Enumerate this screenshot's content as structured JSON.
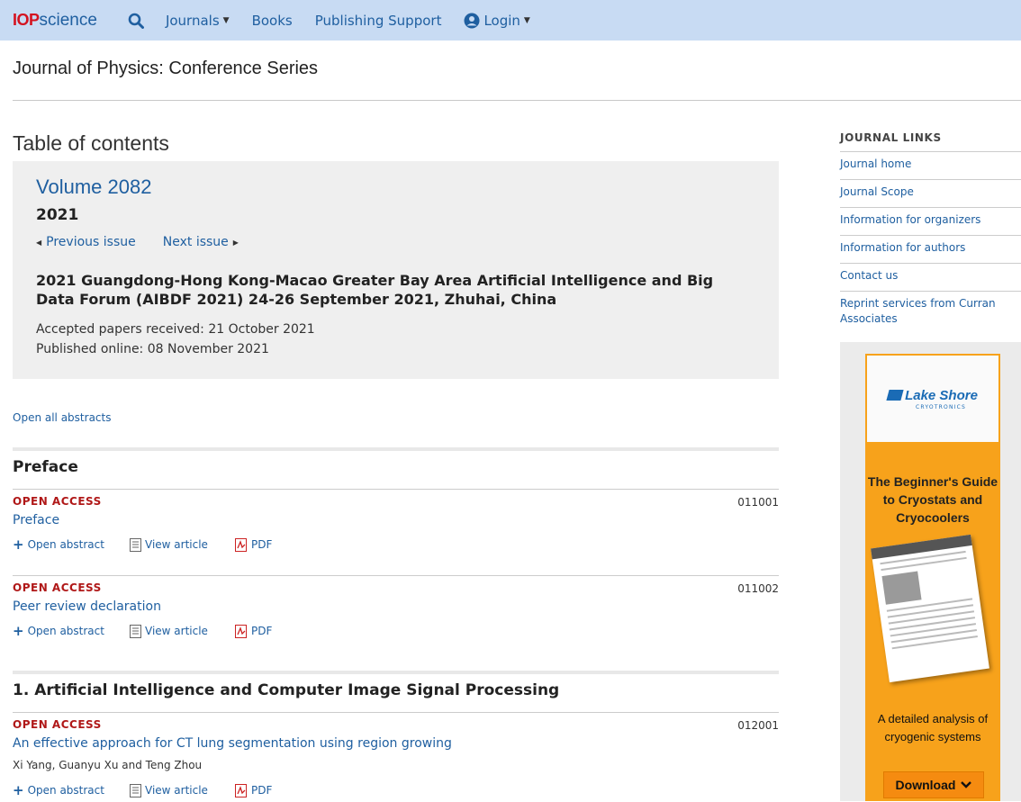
{
  "nav": {
    "logo_iop": "IOP",
    "logo_science": "science",
    "search_icon": "search-icon",
    "items": [
      "Journals",
      "Books",
      "Publishing Support"
    ],
    "login": "Login"
  },
  "journal": {
    "title": "Journal of Physics: Conference Series"
  },
  "toc": {
    "heading": "Table of contents"
  },
  "volume": {
    "title": "Volume 2082",
    "year": "2021",
    "prev": "Previous issue",
    "next": "Next issue",
    "conference": "2021 Guangdong-Hong Kong-Macao Greater Bay Area Artificial Intelligence and Big Data Forum (AIBDF 2021) 24-26 September 2021, Zhuhai, China",
    "accepted": "Accepted papers received: 21 October 2021",
    "published": "Published online: 08 November 2021"
  },
  "open_all": "Open all abstracts",
  "actions": {
    "abstract": "Open abstract",
    "view": "View article",
    "pdf": "PDF"
  },
  "sections": [
    {
      "title": "Preface",
      "articles": [
        {
          "access": "OPEN ACCESS",
          "number": "011001",
          "title": "Preface",
          "authors": ""
        },
        {
          "access": "OPEN ACCESS",
          "number": "011002",
          "title": "Peer review declaration",
          "authors": ""
        }
      ]
    },
    {
      "title": "1. Artificial Intelligence and Computer Image Signal Processing",
      "articles": [
        {
          "access": "OPEN ACCESS",
          "number": "012001",
          "title": "An effective approach for CT lung segmentation using region growing",
          "authors": "Xi Yang, Guanyu Xu and Teng Zhou"
        }
      ]
    }
  ],
  "sidebar": {
    "heading": "JOURNAL LINKS",
    "links": [
      "Journal home",
      "Journal Scope",
      "Information for organizers",
      "Information for authors",
      "Contact us",
      "Reprint services from Curran Associates"
    ]
  },
  "ad": {
    "brand": "Lake Shore",
    "brand_sub": "CRYOTRONICS",
    "headline": "The Beginner's Guide to Cryostats and Cryocoolers",
    "caption": "A detailed analysis of cryogenic systems",
    "button": "Download",
    "accent": "#f7a21b"
  }
}
